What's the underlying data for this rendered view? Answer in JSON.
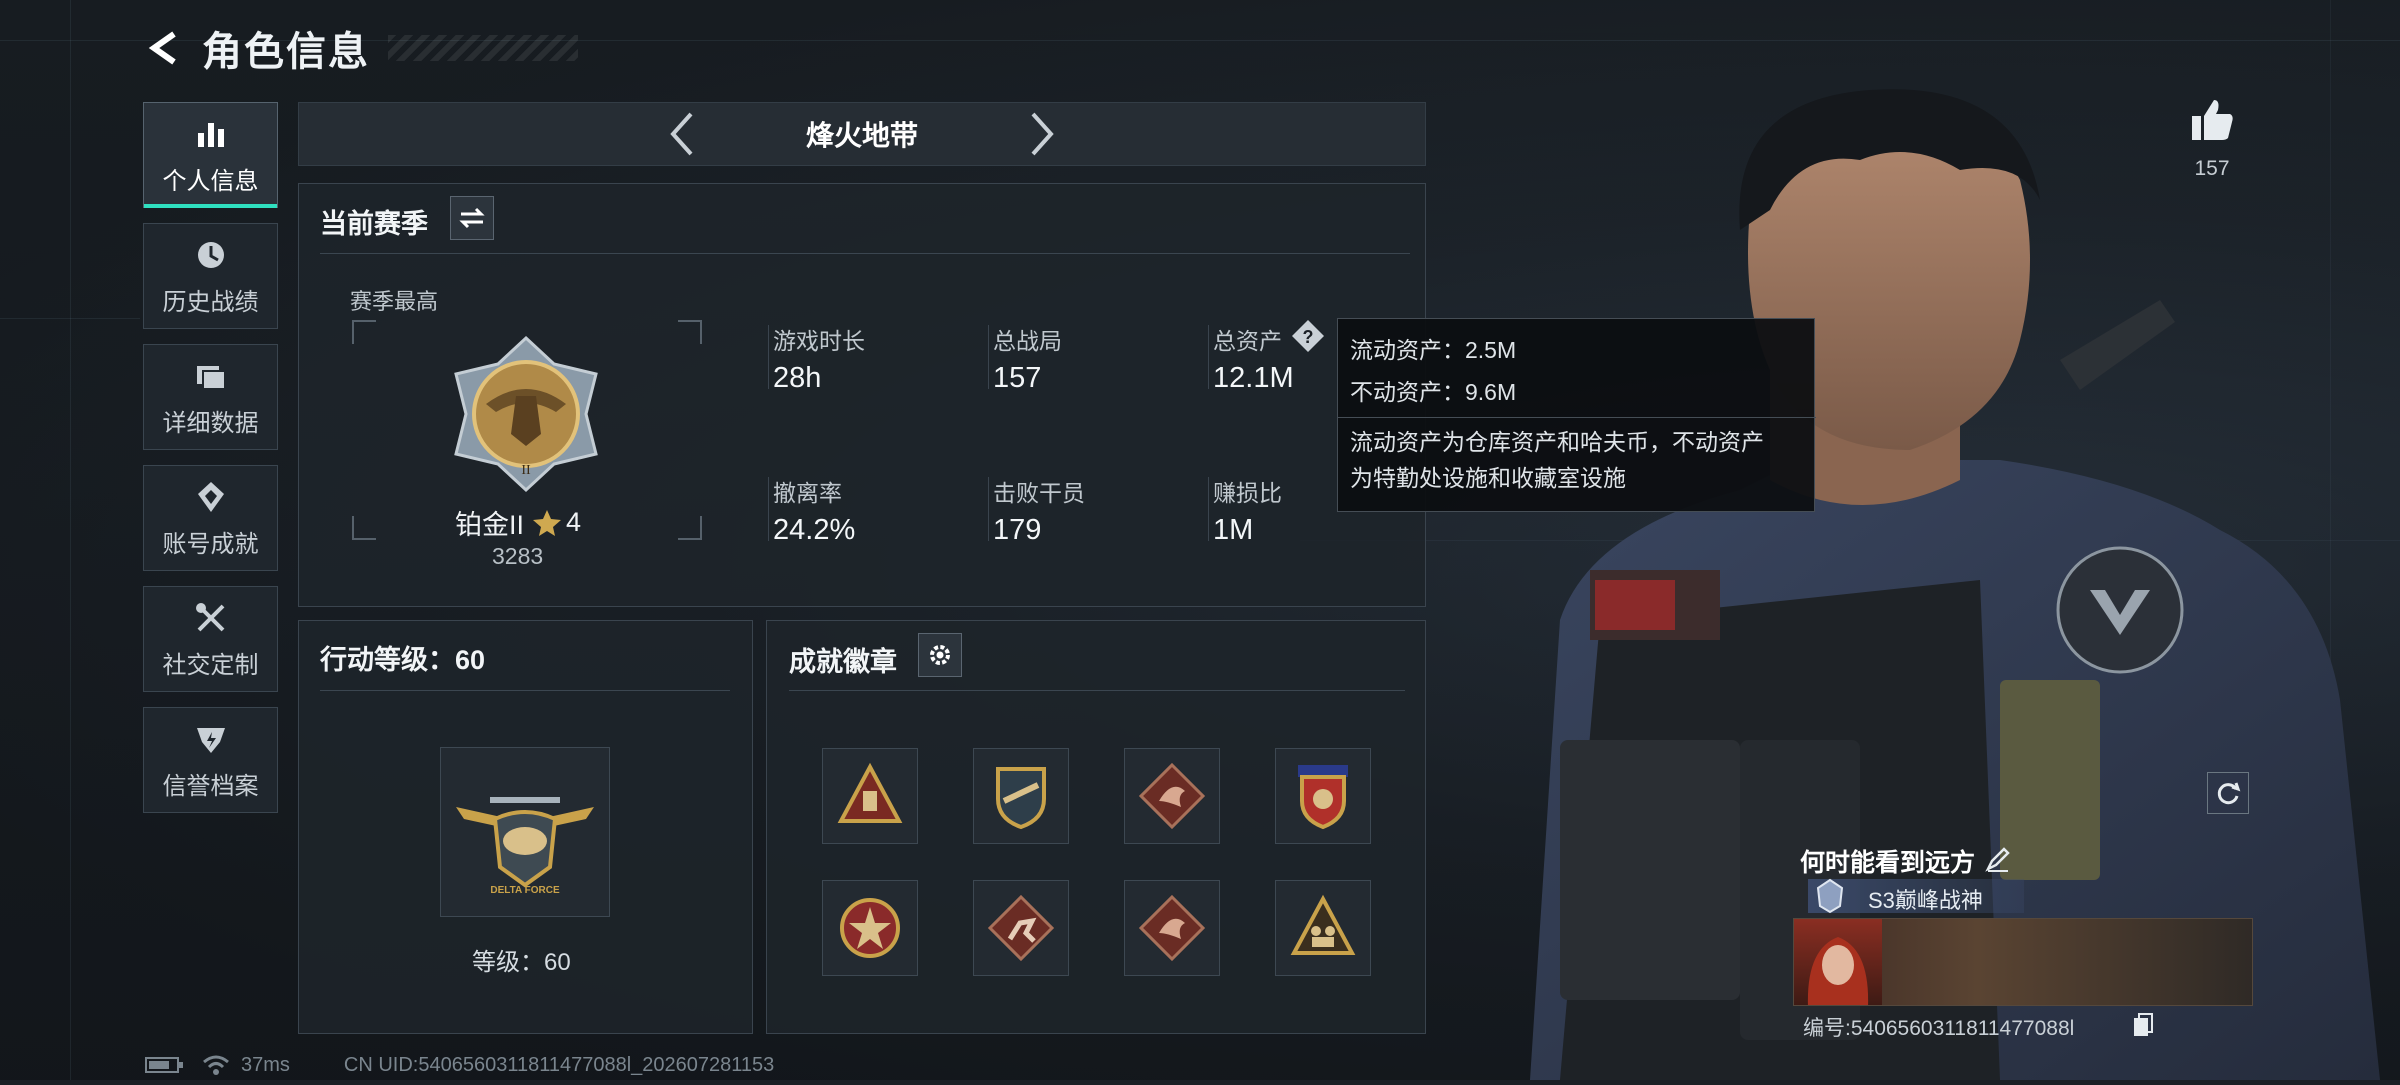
{
  "header": {
    "title": "角色信息"
  },
  "sidebar": {
    "items": [
      {
        "label": "个人信息",
        "icon": "bar-chart-icon",
        "active": true
      },
      {
        "label": "历史战绩",
        "icon": "history-clock-icon",
        "active": false
      },
      {
        "label": "详细数据",
        "icon": "folder-icon",
        "active": false
      },
      {
        "label": "账号成就",
        "icon": "achievement-icon",
        "active": false
      },
      {
        "label": "社交定制",
        "icon": "tools-icon",
        "active": false
      },
      {
        "label": "信誉档案",
        "icon": "credit-shield-icon",
        "active": false
      }
    ]
  },
  "mode": {
    "title": "烽火地带"
  },
  "season": {
    "title": "当前赛季",
    "best_label": "赛季最高",
    "rank_name": "铂金II",
    "rank_stars": "4",
    "rank_score": "3283",
    "stats": [
      {
        "label": "游戏时长",
        "value": "28h"
      },
      {
        "label": "总战局",
        "value": "157"
      },
      {
        "label": "总资产",
        "value": "12.1M"
      },
      {
        "label": "撤离率",
        "value": "24.2%"
      },
      {
        "label": "击败干员",
        "value": "179"
      },
      {
        "label": "赚损比",
        "value": "1M"
      }
    ]
  },
  "tooltip": {
    "liquid": "流动资产：2.5M",
    "fixed": "不动资产：9.6M",
    "desc_line1": "流动资产为仓库资产和哈夫币，不动资产",
    "desc_line2": "为特勤处设施和收藏室设施"
  },
  "action_level": {
    "title": "行动等级：60",
    "level_label": "等级：60",
    "emblem_text": "DELTA FORCE"
  },
  "badges": {
    "title": "成就徽章",
    "items": [
      {
        "icon": "triangle-badge-icon"
      },
      {
        "icon": "shield-badge-icon"
      },
      {
        "icon": "dragon-badge-icon"
      },
      {
        "icon": "stars-shield-badge-icon"
      },
      {
        "icon": "star-emblem-badge-icon"
      },
      {
        "icon": "runner-badge-icon"
      },
      {
        "icon": "dragon-badge-icon"
      },
      {
        "icon": "figures-badge-icon"
      }
    ]
  },
  "character": {
    "likes": "157",
    "card_name": "何时能看到远方",
    "card_title": "S3巅峰战神",
    "card_id": "编号:5406560311811477088l"
  },
  "status": {
    "ping": "37ms",
    "uid": "CN UID:5406560311811477088l_202607281153"
  },
  "colors": {
    "accent": "#2fe0c0",
    "gold": "#c9a24a",
    "panel_border": "#3a444e"
  }
}
